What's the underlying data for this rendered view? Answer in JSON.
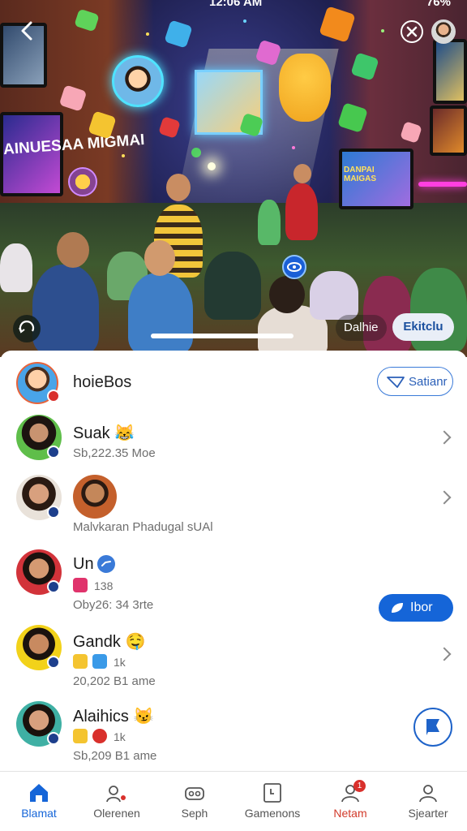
{
  "status_bar": {
    "time": "12:06 AM",
    "battery": "76%"
  },
  "hero": {
    "screen_text_left": "AINUESAA MIGMAI",
    "screen_text_right": "DANPAI MAIGAS",
    "chip_dark_label": "Dalhie",
    "chip_light_label": "Ekitclu"
  },
  "header_row": {
    "name": "hoieBos",
    "follow_button": "Satianr"
  },
  "list": [
    {
      "name": "Suak",
      "emoji": "😹",
      "meta": "Sb,222.35 Moe"
    },
    {
      "name": "",
      "meta": "Malvkaran Phadugal sUAl"
    },
    {
      "name": "Un",
      "count": "138",
      "meta": "Oby26: 34 3rte",
      "action": "Ibor"
    },
    {
      "name": "Gandk",
      "emoji": "🤤",
      "count": "1k",
      "meta": "20,202 B1 ame"
    },
    {
      "name": "Alaihics",
      "emoji": "😼",
      "count": "1k",
      "meta": "Sb,209 B1 ame"
    }
  ],
  "nav": [
    {
      "label": "Blamat",
      "icon": "home-icon",
      "state": "active"
    },
    {
      "label": "Olerenen",
      "icon": "people-icon",
      "state": "normal"
    },
    {
      "label": "Seph",
      "icon": "gamepad-icon",
      "state": "normal"
    },
    {
      "label": "Gamenons",
      "icon": "message-icon",
      "state": "normal"
    },
    {
      "label": "Netam",
      "icon": "profile-alert-icon",
      "state": "alert",
      "badge": "1"
    },
    {
      "label": "Sjearter",
      "icon": "profile-icon",
      "state": "normal"
    }
  ],
  "colors": {
    "accent": "#1565d8",
    "alert": "#d23a2a"
  }
}
